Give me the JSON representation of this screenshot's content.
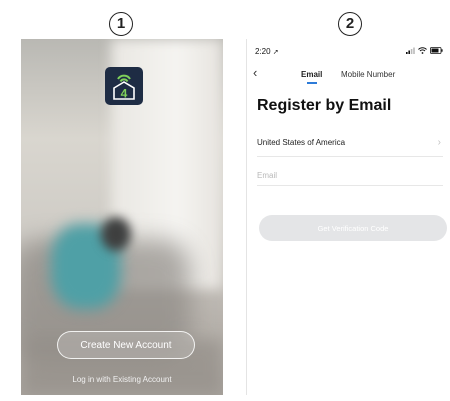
{
  "steps": {
    "one": "1",
    "two": "2"
  },
  "screen1": {
    "logo_icon": "house-wifi-4-icon",
    "logo_digit": "4",
    "create_account_label": "Create New Account",
    "login_label": "Log in with Existing Account"
  },
  "screen2": {
    "status_time": "2:20",
    "tabs": [
      {
        "label": "Email",
        "active": true
      },
      {
        "label": "Mobile Number",
        "active": false
      }
    ],
    "title": "Register by Email",
    "country": "United States of America",
    "email_placeholder": "Email",
    "verify_button_label": "Get Verification Code"
  },
  "colors": {
    "accent": "#2d7bd8",
    "logo_bg": "#1e2c44",
    "logo_green": "#7fd15a",
    "disabled_button": "#e4e5e7"
  }
}
